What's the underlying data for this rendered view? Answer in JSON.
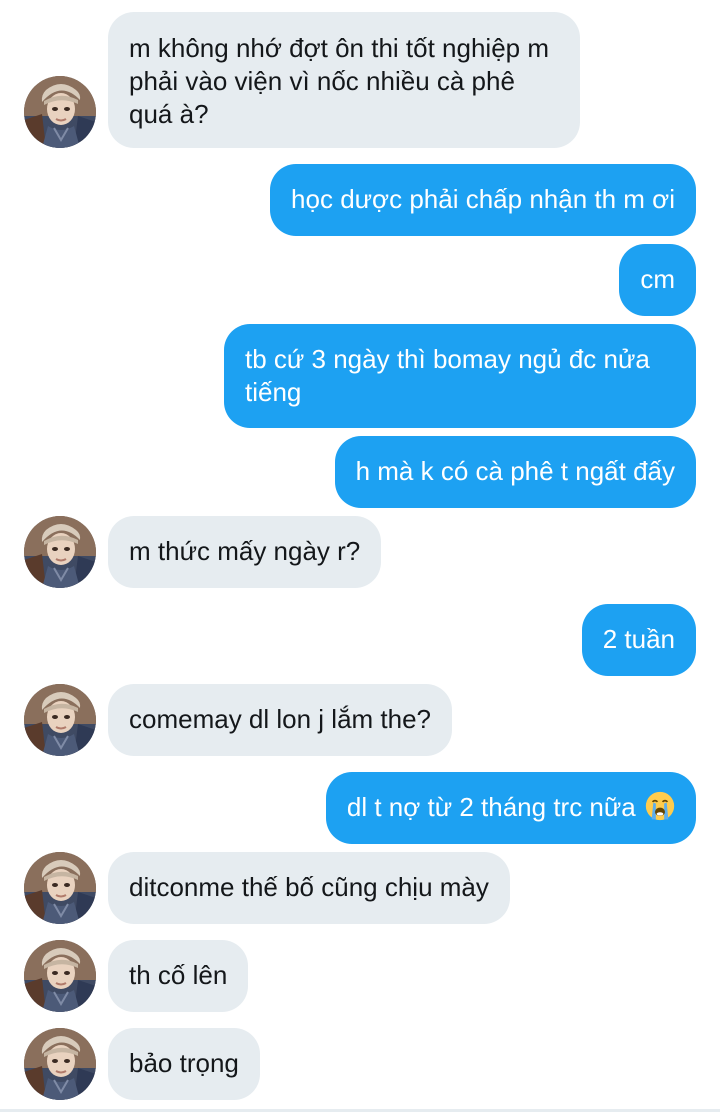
{
  "conversation": {
    "messages": [
      {
        "sender": "them",
        "text": "m không nhớ đợt ôn thi tốt nghiệp m phải vào viện vì nốc nhiều cà phê quá à?"
      },
      {
        "sender": "me",
        "text": "học dược phải chấp nhận th m ơi"
      },
      {
        "sender": "me",
        "text": "cm"
      },
      {
        "sender": "me",
        "text": "tb cứ 3 ngày thì bomay ngủ đc nửa tiếng"
      },
      {
        "sender": "me",
        "text": "h mà k có cà phê t ngất đấy"
      },
      {
        "sender": "them",
        "text": "m thức mấy ngày r?"
      },
      {
        "sender": "me",
        "text": "2 tuần"
      },
      {
        "sender": "them",
        "text": "comemay dl lon j lắm the?"
      },
      {
        "sender": "me",
        "text": "dl t nợ từ 2 tháng trc nữa",
        "emoji": "loudly-crying-face"
      },
      {
        "sender": "them",
        "text": "ditconme thế bố cũng chịu mày"
      },
      {
        "sender": "them",
        "text": "th cố lên"
      },
      {
        "sender": "them",
        "text": "bảo trọng"
      }
    ]
  },
  "colors": {
    "incoming_bubble": "#e6ecf0",
    "outgoing_bubble": "#1da1f2",
    "incoming_text": "#14171a",
    "outgoing_text": "#ffffff"
  }
}
